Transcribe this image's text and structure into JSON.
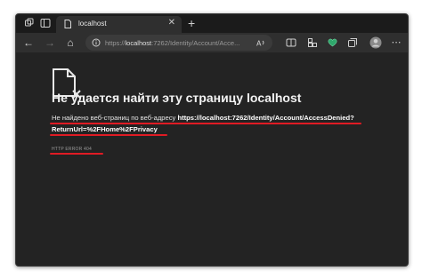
{
  "tab": {
    "title": "localhost",
    "close_glyph": "✕"
  },
  "newtab_glyph": "+",
  "nav": {
    "back": "←",
    "forward": "→",
    "home": "⌂"
  },
  "address": {
    "prefix": "https://",
    "host": "localhost",
    "rest": ":7262/Identity/Account/Acce..."
  },
  "page": {
    "heading": "Не удается найти эту страницу localhost",
    "message_prefix": "Не найдено веб-страниц по веб-адресу ",
    "message_url": "https://localhost:7262/Identity/Account/AccessDenied?",
    "message_url2": "ReturnUrl=%2FHome%2FPrivacy",
    "error_code": "HTTP ERROR 404"
  },
  "colors": {
    "background": "#232323",
    "highlight": "#e01b24"
  },
  "icons": [
    "tab-actions-icon",
    "tab-sidebar-icon",
    "localhost-favicon",
    "back-icon",
    "forward-icon",
    "home-icon",
    "info-icon",
    "read-aloud-icon",
    "split-screen-icon",
    "extensions-icon",
    "copilot-icon",
    "collections-icon",
    "profile-icon",
    "broken-page-icon"
  ]
}
